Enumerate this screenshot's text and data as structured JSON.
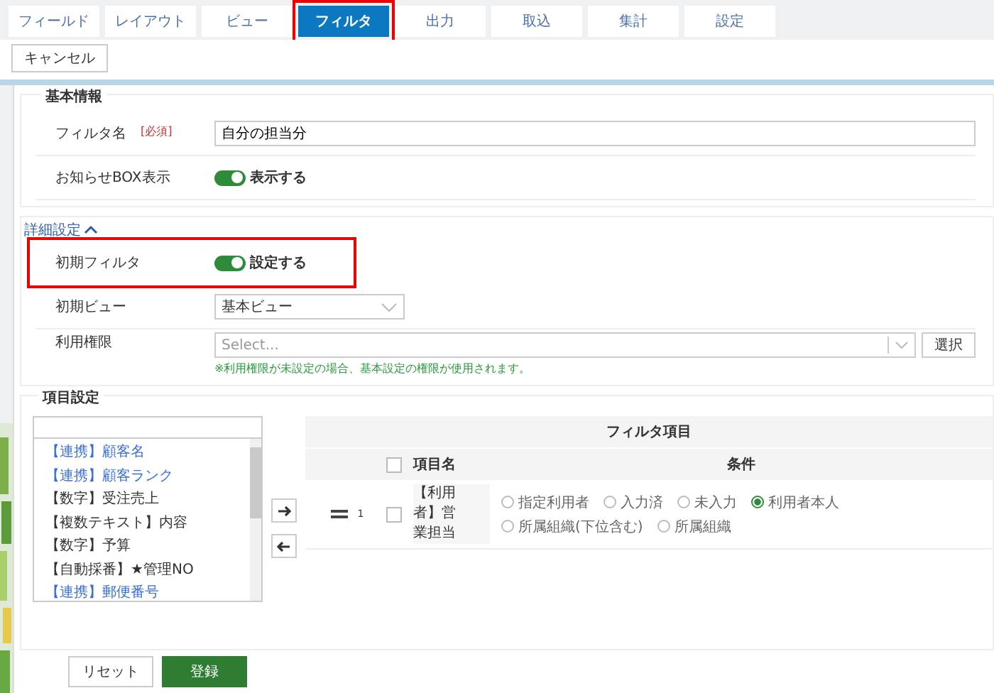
{
  "tabs": [
    {
      "label": "フィールド",
      "selected": false,
      "highlighted": false
    },
    {
      "label": "レイアウト",
      "selected": false,
      "highlighted": false
    },
    {
      "label": "ビュー",
      "selected": false,
      "highlighted": false
    },
    {
      "label": "フィルタ",
      "selected": true,
      "highlighted": true
    },
    {
      "label": "出力",
      "selected": false,
      "highlighted": false
    },
    {
      "label": "取込",
      "selected": false,
      "highlighted": false
    },
    {
      "label": "集計",
      "selected": false,
      "highlighted": false
    },
    {
      "label": "設定",
      "selected": false,
      "highlighted": false
    }
  ],
  "cancel_button": "キャンセル",
  "basic_info": {
    "title": "基本情報",
    "filter_name": {
      "label": "フィルタ名",
      "required": "[必須]",
      "value": "自分の担当分"
    },
    "notice_box": {
      "label": "お知らせBOX表示",
      "on": true,
      "text": "表示する"
    }
  },
  "details": {
    "title": "詳細設定",
    "expanded": true,
    "initial_filter": {
      "label": "初期フィルタ",
      "on": true,
      "text": "設定する",
      "highlighted": true
    },
    "initial_view": {
      "label": "初期ビュー",
      "value": "基本ビュー"
    },
    "permission": {
      "label": "利用権限",
      "placeholder": "Select...",
      "button": "選択",
      "note": "※利用権限が未設定の場合、基本設定の権限が使用されます。"
    }
  },
  "item_settings": {
    "title": "項目設定",
    "fields": [
      {
        "label": "【連携】顧客名",
        "color": "#3a6fd8"
      },
      {
        "label": "【連携】顧客ランク",
        "color": "#3a6fd8"
      },
      {
        "label": "【数字】受注売上",
        "color": "#333333"
      },
      {
        "label": "【複数テキスト】内容",
        "color": "#333333"
      },
      {
        "label": "【数字】予算",
        "color": "#333333"
      },
      {
        "label": "【自動採番】★管理NO",
        "color": "#333333"
      },
      {
        "label": "【連携】郵便番号",
        "color": "#3a6fd8"
      }
    ],
    "table": {
      "title": "フィルタ項目",
      "columns": [
        "項目名",
        "条件"
      ],
      "header_checked": false,
      "rows": [
        {
          "number": "1",
          "checked": false,
          "name": "【利用者】営業担当",
          "options": [
            {
              "label": "指定利用者",
              "selected": false
            },
            {
              "label": "入力済",
              "selected": false
            },
            {
              "label": "未入力",
              "selected": false
            },
            {
              "label": "利用者本人",
              "selected": true
            },
            {
              "label": "所属組織(下位含む)",
              "selected": false
            },
            {
              "label": "所属組織",
              "selected": false
            }
          ]
        }
      ]
    }
  },
  "footer": {
    "reset": "リセット",
    "submit": "登録"
  }
}
